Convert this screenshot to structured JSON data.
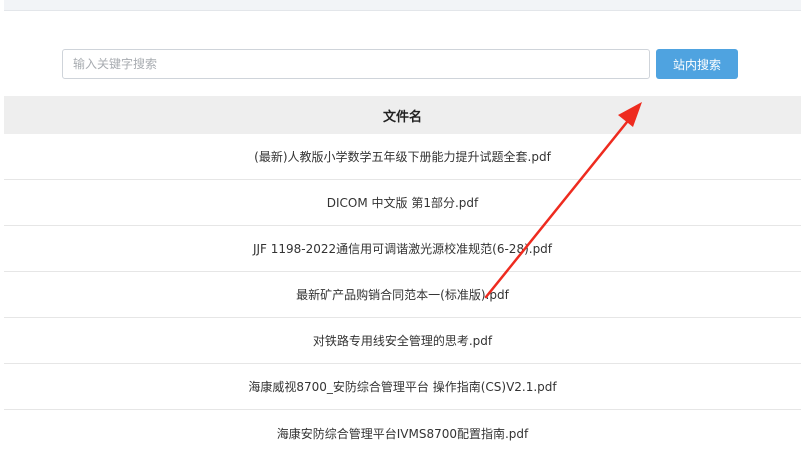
{
  "search": {
    "placeholder": "输入关键字搜索",
    "value": "",
    "button_label": "站内搜索"
  },
  "table": {
    "header": "文件名",
    "rows": [
      "(最新)人教版小学数学五年级下册能力提升试题全套.pdf",
      "DICOM 中文版 第1部分.pdf",
      "JJF 1198-2022通信用可调谐激光源校准规范(6-28).pdf",
      "最新矿产品购销合同范本一(标准版).pdf",
      "对铁路专用线安全管理的思考.pdf",
      "海康威视8700_安防综合管理平台 操作指南(CS)V2.1.pdf",
      "海康安防综合管理平台IVMS8700配置指南.pdf"
    ]
  },
  "colors": {
    "accent_button": "#4fa3e0",
    "annotation_arrow": "#ee2b1f",
    "header_bg": "#eeeeee"
  }
}
